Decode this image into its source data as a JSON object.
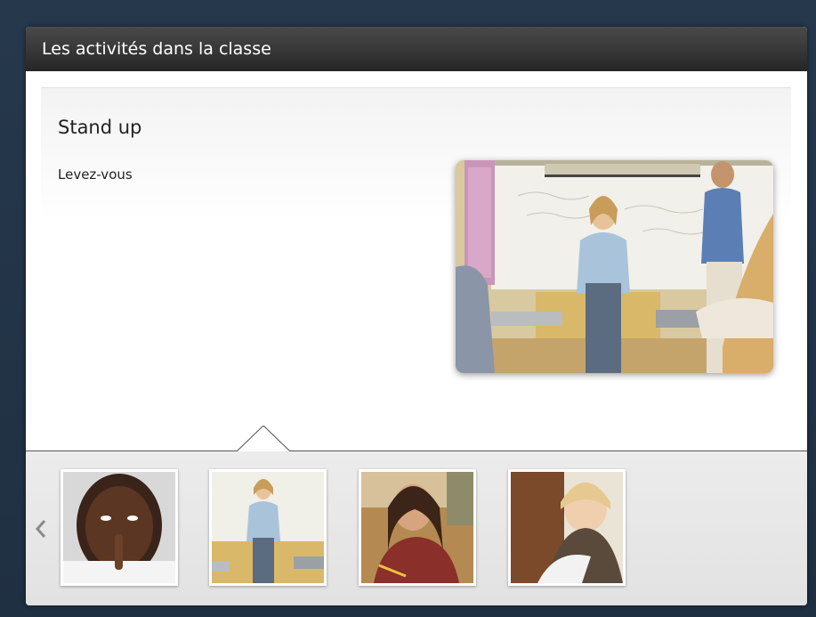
{
  "window": {
    "title": "Les activités dans la classe"
  },
  "card": {
    "title": "Stand up",
    "translation": "Levez-vous"
  },
  "main_image": {
    "description_icon": "classroom-standing-photo"
  },
  "carousel": {
    "prev_icon": "chevron-left-icon",
    "thumbnails": [
      {
        "id": "quiet",
        "icon": "student-finger-on-lips-photo"
      },
      {
        "id": "stand-up",
        "icon": "student-standing-photo",
        "selected": true
      },
      {
        "id": "write",
        "icon": "student-writing-photo"
      },
      {
        "id": "read",
        "icon": "student-reading-photo"
      }
    ]
  },
  "colors": {
    "titlebar": "#333333",
    "frame": "#26384c",
    "strip": "#e8e8e8"
  }
}
